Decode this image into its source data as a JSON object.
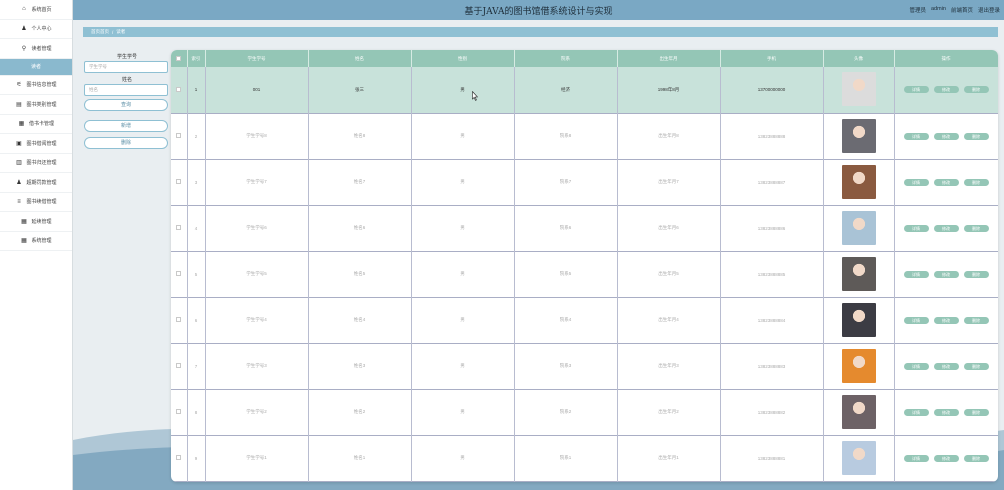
{
  "header": {
    "title": "基于JAVA的图书馆借系统设计与实现",
    "user_role": "管理员",
    "user_name": "admin",
    "personal_link": "前端首页",
    "logout_link": "退出登录"
  },
  "breadcrumb": {
    "home": "首页首页",
    "sep": "/",
    "current": "读者"
  },
  "sidebar": {
    "items": [
      {
        "label": "系统首页",
        "icon": "home-icon",
        "glyph": "⌂"
      },
      {
        "label": "个人中心",
        "icon": "person-icon",
        "glyph": "♟"
      },
      {
        "label": "读者管理",
        "icon": "pin-icon",
        "glyph": "⚲"
      },
      {
        "label": "读者",
        "icon": "",
        "glyph": "",
        "sub": true
      },
      {
        "label": "图书信息管理",
        "icon": "sliders-icon",
        "glyph": "⚟"
      },
      {
        "label": "图书类别管理",
        "icon": "table-icon",
        "glyph": "▤"
      },
      {
        "label": "借书卡管理",
        "icon": "grid-icon",
        "glyph": "▦"
      },
      {
        "label": "图书借阅管理",
        "icon": "calendar-icon",
        "glyph": "▣"
      },
      {
        "label": "图书归还管理",
        "icon": "chart-icon",
        "glyph": "▥"
      },
      {
        "label": "超期罚款管理",
        "icon": "user-icon",
        "glyph": "♟"
      },
      {
        "label": "图书续借管理",
        "icon": "stack-icon",
        "glyph": "≡"
      },
      {
        "label": "延续管理",
        "icon": "grid-icon",
        "glyph": "▦"
      },
      {
        "label": "系统管理",
        "icon": "grid-icon",
        "glyph": "▦"
      }
    ]
  },
  "search": {
    "student_no_label": "学生学号",
    "student_no_placeholder": "学生学号",
    "name_label": "姓名",
    "name_placeholder": "姓名",
    "search_button": "查询",
    "add_button": "新增",
    "delete_button": "删除"
  },
  "table": {
    "columns": [
      "",
      "索引",
      "学生学号",
      "姓名",
      "性别",
      "院系",
      "出生年月",
      "手机",
      "头像",
      "操作"
    ],
    "actions": [
      "详情",
      "修改",
      "删除"
    ],
    "rows": [
      {
        "index": "1",
        "student_no": "001",
        "name": "张三",
        "gender": "男",
        "dept": "经济",
        "birth": "1998年8月",
        "phone": "13700000000",
        "avatar_color": "#dcdcdc",
        "selected": true
      },
      {
        "index": "2",
        "student_no": "学生学号8",
        "name": "姓名8",
        "gender": "男",
        "dept": "院系8",
        "birth": "出生年月8",
        "phone": "13823888888",
        "avatar_color": "#6b6b72"
      },
      {
        "index": "3",
        "student_no": "学生学号7",
        "name": "姓名7",
        "gender": "男",
        "dept": "院系7",
        "birth": "出生年月7",
        "phone": "13823888887",
        "avatar_color": "#8a5a40"
      },
      {
        "index": "4",
        "student_no": "学生学号6",
        "name": "姓名6",
        "gender": "男",
        "dept": "院系6",
        "birth": "出生年月6",
        "phone": "13823888886",
        "avatar_color": "#a9c3d6"
      },
      {
        "index": "5",
        "student_no": "学生学号5",
        "name": "姓名5",
        "gender": "男",
        "dept": "院系5",
        "birth": "出生年月5",
        "phone": "13823888885",
        "avatar_color": "#5e5a58"
      },
      {
        "index": "6",
        "student_no": "学生学号4",
        "name": "姓名4",
        "gender": "男",
        "dept": "院系4",
        "birth": "出生年月4",
        "phone": "13823888884",
        "avatar_color": "#3c3c44"
      },
      {
        "index": "7",
        "student_no": "学生学号3",
        "name": "姓名3",
        "gender": "男",
        "dept": "院系3",
        "birth": "出生年月3",
        "phone": "13823888883",
        "avatar_color": "#e58a2e"
      },
      {
        "index": "8",
        "student_no": "学生学号2",
        "name": "姓名2",
        "gender": "男",
        "dept": "院系2",
        "birth": "出生年月2",
        "phone": "13823888882",
        "avatar_color": "#6d6266"
      },
      {
        "index": "9",
        "student_no": "学生学号1",
        "name": "姓名1",
        "gender": "男",
        "dept": "院系1",
        "birth": "出生年月1",
        "phone": "13823888881",
        "avatar_color": "#b8cbe0"
      }
    ]
  },
  "colors": {
    "accent": "#94c6b6",
    "header": "#7aa8c4",
    "breadcrumb": "#8fc0d3",
    "selected_row": "#c8e2da"
  }
}
